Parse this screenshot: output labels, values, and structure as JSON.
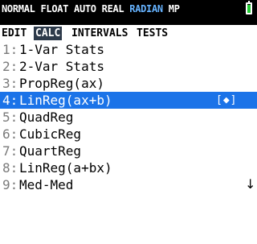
{
  "status_bar": {
    "modes_before": "NORMAL FLOAT AUTO REAL ",
    "angle_mode": "RADIAN",
    "modes_after": " MP",
    "battery_level": 0.9,
    "colors": {
      "accent": "#66b3ff",
      "battery": "#22cc33"
    }
  },
  "tabs": [
    {
      "label": "EDIT",
      "active": false
    },
    {
      "label": "CALC",
      "active": true
    },
    {
      "label": "INTERVALS",
      "active": false
    },
    {
      "label": "TESTS",
      "active": false
    }
  ],
  "menu": {
    "items": [
      {
        "num": "1:",
        "label": "1-Var Stats"
      },
      {
        "num": "2:",
        "label": "2-Var Stats"
      },
      {
        "num": "3:",
        "label": "PropReg(ax)"
      },
      {
        "num": "4:",
        "label": "LinReg(ax+b)",
        "selected": true,
        "hint": "[◆]"
      },
      {
        "num": "5:",
        "label": "QuadReg"
      },
      {
        "num": "6:",
        "label": "CubicReg"
      },
      {
        "num": "7:",
        "label": "QuartReg"
      },
      {
        "num": "8:",
        "label": "LinReg(a+bx)"
      },
      {
        "num": "9:",
        "label": "Med-Med"
      }
    ],
    "more_indicator": "↓",
    "selection_color": "#1b73e8"
  }
}
